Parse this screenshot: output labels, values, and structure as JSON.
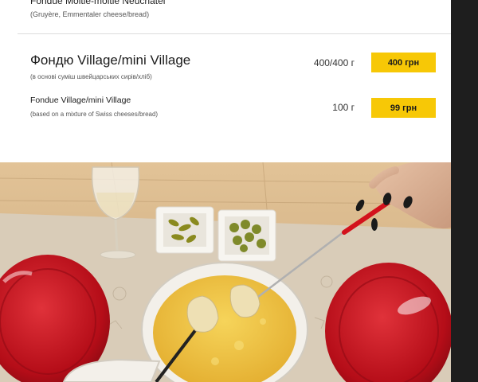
{
  "menu": {
    "prev_item": {
      "name": "Fondue Moitie-moitie Neuchatel",
      "description": "(Gruyère, Emmentaler cheese/bread)"
    },
    "items": [
      {
        "name": "Фондю Village/mini Village",
        "description": "(в основі суміш швейцарських сирів/хліб)",
        "weight": "400/400 г",
        "price": "400 грн"
      },
      {
        "name": "Fondue Village/mini Village",
        "description": "(based on a mixture of Swiss cheeses/bread)",
        "weight": "100 г",
        "price": "99 грн"
      }
    ]
  },
  "colors": {
    "price_badge": "#f7c806",
    "plate_red": "#c8101c",
    "cheese": "#f0c23a",
    "table_wood": "#d9b88c"
  }
}
